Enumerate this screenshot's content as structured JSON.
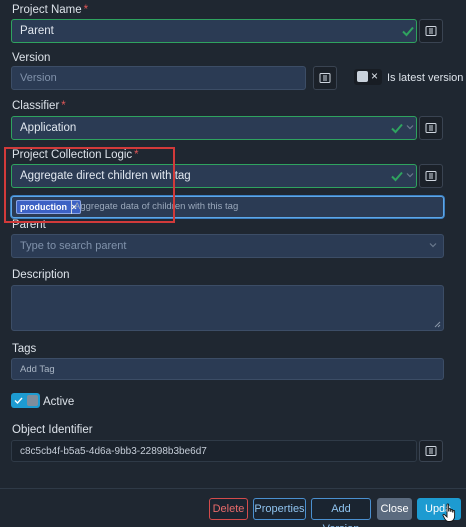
{
  "fields": {
    "project_name": {
      "label": "Project Name",
      "required": "*",
      "value": "Parent"
    },
    "version": {
      "label": "Version",
      "placeholder": "Version",
      "latest_label": "Is latest version"
    },
    "classifier": {
      "label": "Classifier",
      "required": "*",
      "value": "Application"
    },
    "collection_logic": {
      "label": "Project Collection Logic",
      "required": "*",
      "value": "Aggregate direct children with tag"
    },
    "tag_filter": {
      "chip": "production",
      "chip_remove": "×",
      "placeholder": "Aggregate data of children with this tag"
    },
    "parent": {
      "label": "Parent",
      "placeholder": "Type to search parent"
    },
    "description": {
      "label": "Description",
      "value": ""
    },
    "tags": {
      "label": "Tags",
      "placeholder": "Add Tag"
    },
    "active": {
      "label": "Active"
    },
    "object_identifier": {
      "label": "Object Identifier",
      "value": "c8c5cb4f-b5a5-4d6a-9bb3-22898b3be6d7"
    }
  },
  "latest_checkbox_mark": "×",
  "footer": {
    "delete": "Delete",
    "properties": "Properties",
    "add_version": "Add Version",
    "close": "Close",
    "update": "Upda"
  },
  "colors": {
    "accent": "#1d9bd1",
    "valid": "#2fa35f",
    "danger": "#e05757",
    "highlight": "#d13a3a"
  },
  "icons": [
    "checkmark-icon",
    "chevron-down-icon",
    "api-key-icon",
    "cursor-hand-icon"
  ]
}
